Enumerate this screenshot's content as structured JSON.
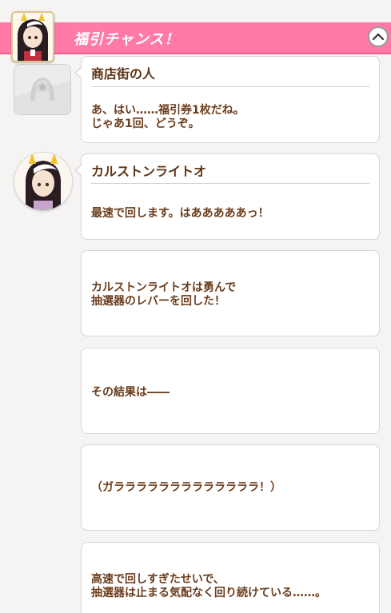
{
  "header": {
    "title": "福引チャンス！",
    "collapse_icon": "chevron-up-icon"
  },
  "colors": {
    "header_bg": "#ff7aa8",
    "text": "#6b3d1c"
  },
  "messages": [
    {
      "speaker": "商店街の人",
      "lines": [
        "あ、はい……福引券1枚だね。",
        "じゃあ1回、どうぞ。"
      ]
    },
    {
      "speaker": "カルストンライトオ",
      "lines": [
        "最速で回します。はあああああっ！"
      ]
    },
    {
      "lines": [
        "カルストンライトオは勇んで",
        "抽選器のレバーを回した！"
      ]
    },
    {
      "lines": [
        "その結果は――"
      ]
    },
    {
      "lines": [
        "（ガラララララララララララララ！）"
      ]
    },
    {
      "lines": [
        "高速で回しすぎたせいで、",
        "抽選器は止まる気配なく回り続けている……。"
      ]
    }
  ]
}
